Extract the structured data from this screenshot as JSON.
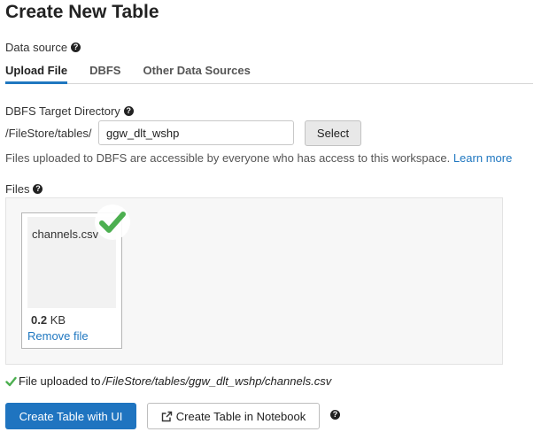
{
  "page": {
    "title": "Create New Table"
  },
  "data_source": {
    "label": "Data source",
    "help_icon": "question-circle-icon",
    "tabs": [
      {
        "label": "Upload File",
        "active": true
      },
      {
        "label": "DBFS",
        "active": false
      },
      {
        "label": "Other Data Sources",
        "active": false
      }
    ]
  },
  "target_dir": {
    "label": "DBFS Target Directory",
    "prefix": "/FileStore/tables/",
    "value": "ggw_dlt_wshp",
    "select_label": "Select"
  },
  "info": {
    "text": "Files uploaded to DBFS are accessible by everyone who has access to this workspace.",
    "link": "Learn more"
  },
  "files": {
    "label": "Files",
    "items": [
      {
        "name": "channels.csv",
        "size_value": "0.2",
        "size_unit": "KB",
        "remove_label": "Remove file",
        "status_icon": "check-icon"
      }
    ]
  },
  "status": {
    "prefix": "File uploaded to",
    "path": "/FileStore/tables/ggw_dlt_wshp/channels.csv"
  },
  "actions": {
    "primary": "Create Table with UI",
    "secondary": "Create Table in Notebook",
    "secondary_icon": "external-link-icon"
  },
  "colors": {
    "accent": "#1f74c0",
    "success": "#4caf50"
  }
}
